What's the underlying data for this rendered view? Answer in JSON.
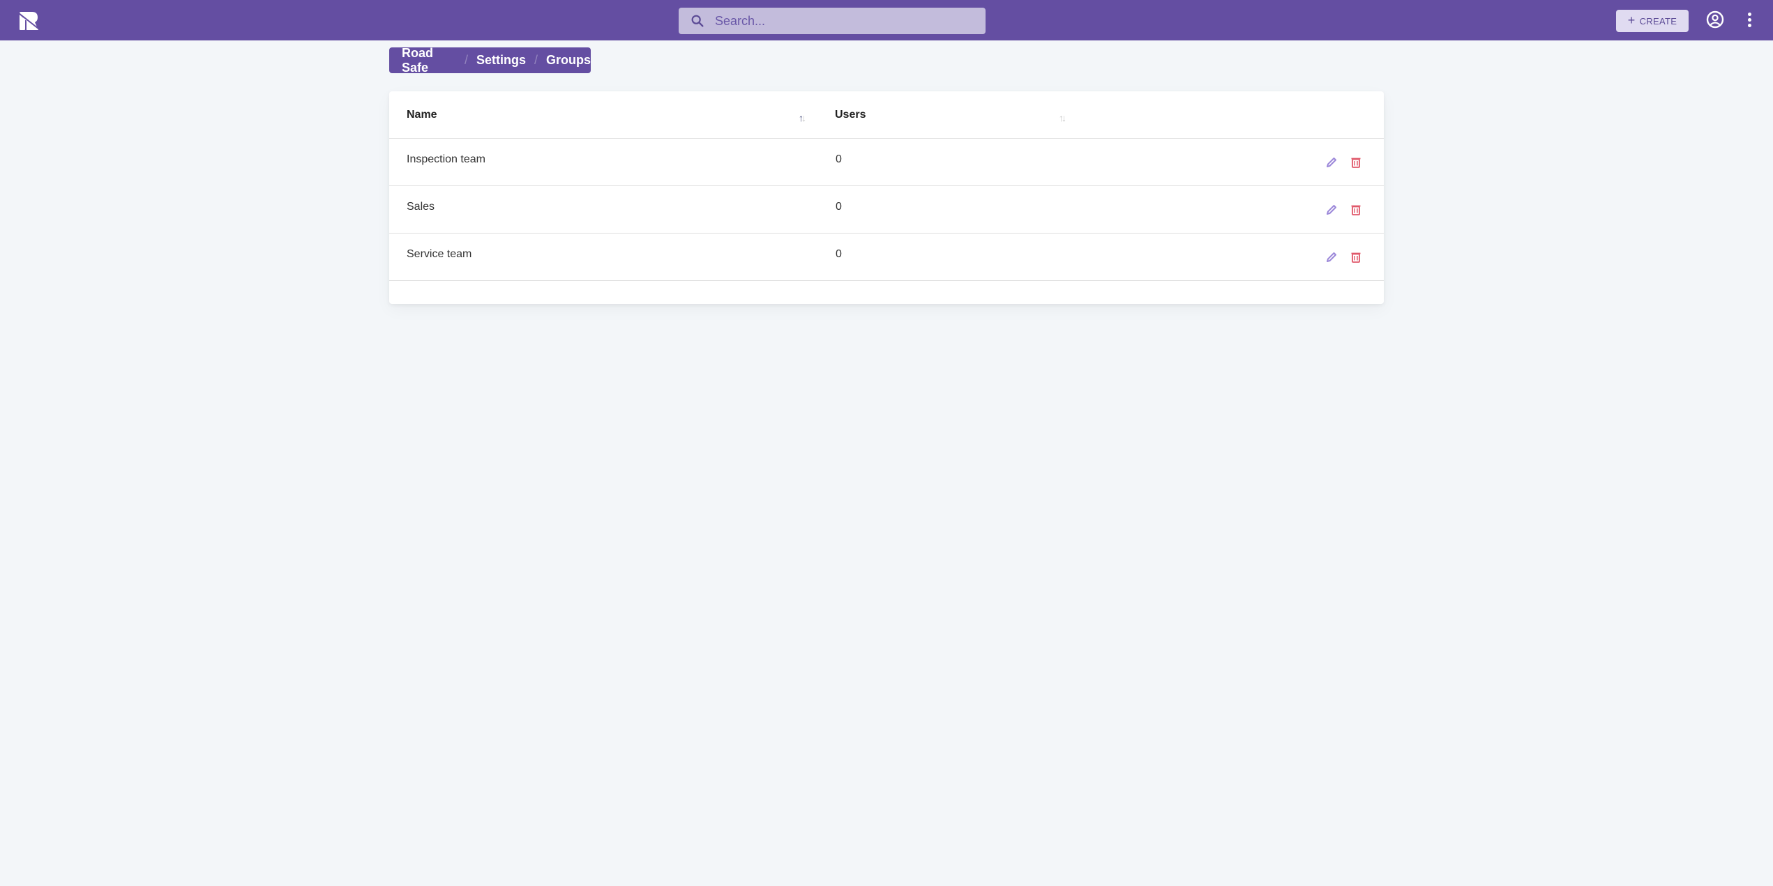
{
  "appbar": {
    "logo": "road-safe-logo",
    "search": {
      "placeholder": "Search...",
      "value": "",
      "icon": "search-icon"
    },
    "create_button": {
      "label": "CREATE",
      "icon": "plus-icon"
    },
    "account_icon": "account-circle-icon",
    "menu_icon": "more-vert-icon"
  },
  "breadcrumb": {
    "items": [
      "Road Safe",
      "Settings",
      "Groups"
    ],
    "separator": "/"
  },
  "table": {
    "columns": [
      {
        "label": "Name",
        "sort": "ascending"
      },
      {
        "label": "Users",
        "sort": "none"
      }
    ],
    "rows": [
      {
        "name": "Inspection team",
        "users": "0"
      },
      {
        "name": "Sales",
        "users": "0"
      },
      {
        "name": "Service team",
        "users": "0"
      }
    ],
    "row_actions": [
      "edit",
      "delete"
    ]
  },
  "colors": {
    "brand": "#644ea2",
    "search_bg": "#c3bcdc",
    "page_bg": "#f3f6f9",
    "edit_icon": "#9b87d9",
    "delete_icon": "#e0586a"
  }
}
